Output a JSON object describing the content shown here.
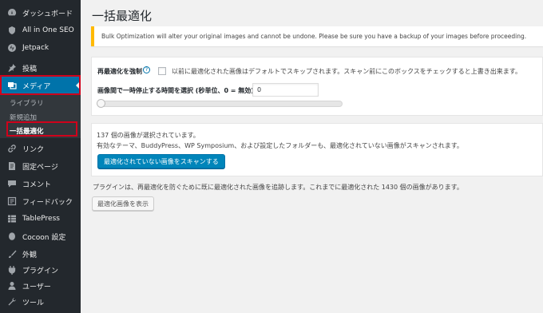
{
  "sidebar": {
    "items": [
      {
        "label": "ダッシュボード",
        "icon": "dashboard-icon"
      },
      {
        "label": "All in One SEO",
        "icon": "aioseo-icon"
      },
      {
        "label": "Jetpack",
        "icon": "jetpack-icon"
      },
      {
        "label": "投稿",
        "icon": "pin-icon"
      },
      {
        "label": "メディア",
        "icon": "media-icon"
      },
      {
        "label": "リンク",
        "icon": "link-icon"
      },
      {
        "label": "固定ページ",
        "icon": "page-icon"
      },
      {
        "label": "コメント",
        "icon": "comment-icon"
      },
      {
        "label": "フィードバック",
        "icon": "feedback-icon"
      },
      {
        "label": "TablePress",
        "icon": "table-icon"
      },
      {
        "label": "Cocoon 設定",
        "icon": "cocoon-icon"
      },
      {
        "label": "外観",
        "icon": "brush-icon"
      },
      {
        "label": "プラグイン",
        "icon": "plugin-icon"
      },
      {
        "label": "ユーザー",
        "icon": "user-icon"
      },
      {
        "label": "ツール",
        "icon": "wrench-icon"
      }
    ],
    "submenu": [
      "ライブラリ",
      "新規追加",
      "一括最適化"
    ]
  },
  "page": {
    "title": "一括最適化",
    "notice": "Bulk Optimization will alter your original images and cannot be undone. Please be sure you have a backup of your images before proceeding."
  },
  "settings": {
    "force_label": "再最適化を強制",
    "force_help": "?",
    "force_desc": "以前に最適化された画像はデフォルトでスキップされます。スキャン前にこのボックスをチェックすると上書き出来ます。",
    "pause_label": "画像間で一時停止する時間を選択 (秒単位、0 = 無効)",
    "pause_value": "0",
    "pause_slider": 0
  },
  "scan": {
    "selected_text": "137 個の画像が選択されています。",
    "info_text": "有効なテーマ、BuddyPress、WP Symposium、および設定したフォルダーも、最適化されていない画像がスキャンされます。",
    "scan_button": "最適化されていない画像をスキャンする"
  },
  "footer": {
    "tracking_text": "プラグインは、再最適化を防ぐために既に最適化された画像を追跡します。これまでに最適化された 1430 個の画像があります。",
    "show_button": "最適化画像を表示"
  },
  "colors": {
    "sidebar_bg": "#23282d",
    "active_bg": "#0073aa",
    "highlight": "#d0021b",
    "notice_border": "#ffb900"
  }
}
